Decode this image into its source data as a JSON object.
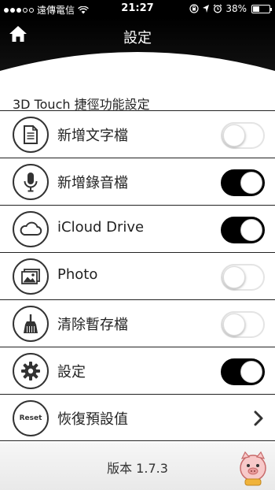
{
  "status_bar": {
    "carrier": "遠傳電信",
    "time": "21:27",
    "battery_text": "38%",
    "battery_level": 0.38
  },
  "header": {
    "title": "設定",
    "home_icon": "home-icon"
  },
  "section_title": "3D Touch 捷徑功能設定",
  "items": [
    {
      "label": "新增文字檔",
      "icon": "document-icon",
      "control": "toggle",
      "on": false
    },
    {
      "label": "新增錄音檔",
      "icon": "microphone-icon",
      "control": "toggle",
      "on": true
    },
    {
      "label": "iCloud Drive",
      "icon": "cloud-icon",
      "control": "toggle",
      "on": true
    },
    {
      "label": "Photo",
      "icon": "photo-icon",
      "control": "toggle",
      "on": false
    },
    {
      "label": "清除暫存檔",
      "icon": "broom-icon",
      "control": "toggle",
      "on": false
    },
    {
      "label": "設定",
      "icon": "gear-icon",
      "control": "toggle",
      "on": true
    },
    {
      "label": "恢復預設值",
      "icon": "reset-icon",
      "icon_text": "Reset",
      "control": "chevron"
    }
  ],
  "footer": {
    "version": "版本 1.7.3"
  },
  "colors": {
    "toggle_on": "#000000",
    "header_bg": "#000000",
    "divider": "#222222"
  }
}
